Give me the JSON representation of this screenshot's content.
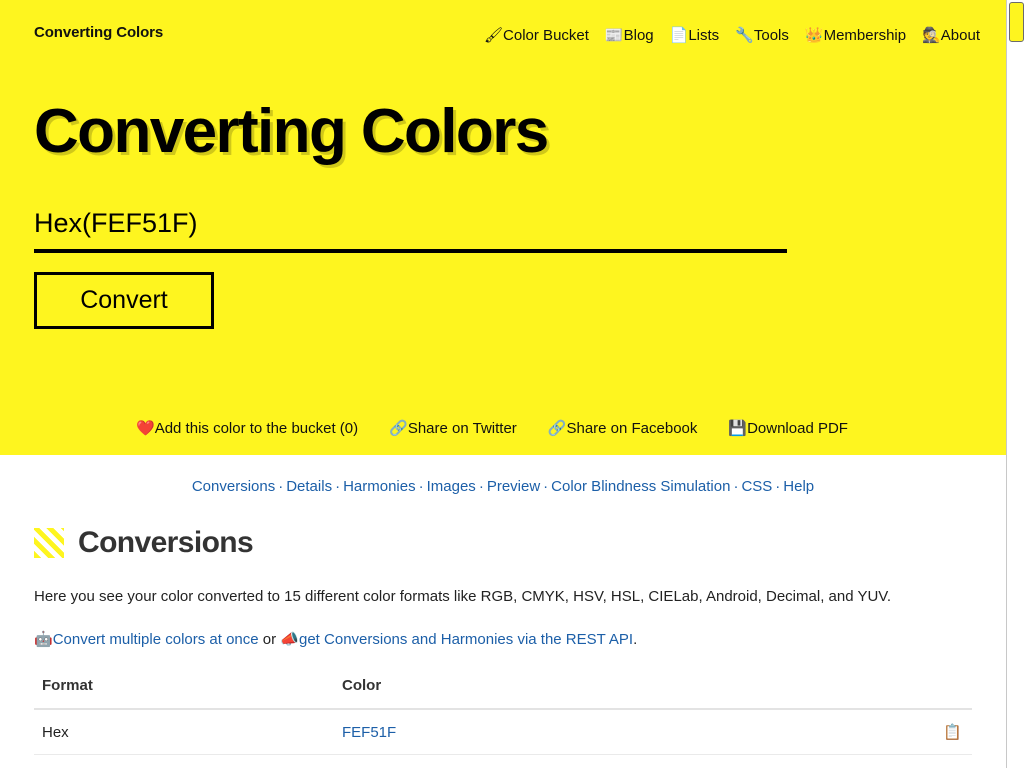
{
  "header": {
    "brand": "Converting Colors",
    "nav": [
      {
        "label": "Color Bucket",
        "icon": "paintbrush-icon",
        "glyph": "🖌"
      },
      {
        "label": "Blog",
        "icon": "newspaper-icon",
        "glyph": "📰"
      },
      {
        "label": "Lists",
        "icon": "page-icon",
        "glyph": "📄"
      },
      {
        "label": "Tools",
        "icon": "wrench-icon",
        "glyph": "🔧"
      },
      {
        "label": "Membership",
        "icon": "crown-icon",
        "glyph": "👑"
      },
      {
        "label": "About",
        "icon": "detective-icon",
        "glyph": "🕵"
      }
    ]
  },
  "hero": {
    "title": "Converting Colors",
    "input_value": "Hex(FEF51F)",
    "input_placeholder": "Hex(FEF51F)",
    "convert_label": "Convert",
    "actions": [
      {
        "label": "Add this color to the bucket (0)",
        "icon": "heart-icon",
        "glyph": "❤️"
      },
      {
        "label": "Share on Twitter",
        "icon": "link-icon",
        "glyph": "🔗"
      },
      {
        "label": "Share on Facebook",
        "icon": "link-icon",
        "glyph": "🔗"
      },
      {
        "label": "Download PDF",
        "icon": "floppy-disk-icon",
        "glyph": "💾"
      }
    ],
    "background_color": "#FEF51F"
  },
  "section_nav": [
    "Conversions",
    "Details",
    "Harmonies",
    "Images",
    "Preview",
    "Color Blindness Simulation",
    "CSS",
    "Help"
  ],
  "section": {
    "icon": "yellow-stripes-icon",
    "title": "Conversions",
    "description": "Here you see your color converted to 15 different color formats like RGB, CMYK, HSV, HSL, CIELab, Android, Decimal, and YUV.",
    "links_line": {
      "bulk_icon": "robot-icon",
      "bulk_glyph": "🤖",
      "bulk_label": "Convert multiple colors at once",
      "middle_text": " or ",
      "api_icon": "megaphone-icon",
      "api_glyph": "📣",
      "api_label": "get Conversions and Harmonies via the REST API",
      "trailing": "."
    }
  },
  "table": {
    "columns": [
      "Format",
      "Color"
    ],
    "rows": [
      {
        "format": "Hex",
        "color": "FEF51F",
        "copy_icon": "clipboard-icon",
        "copy_glyph": "📋"
      }
    ]
  },
  "scrollbar": {
    "thumb_color": "#FEF51F"
  }
}
